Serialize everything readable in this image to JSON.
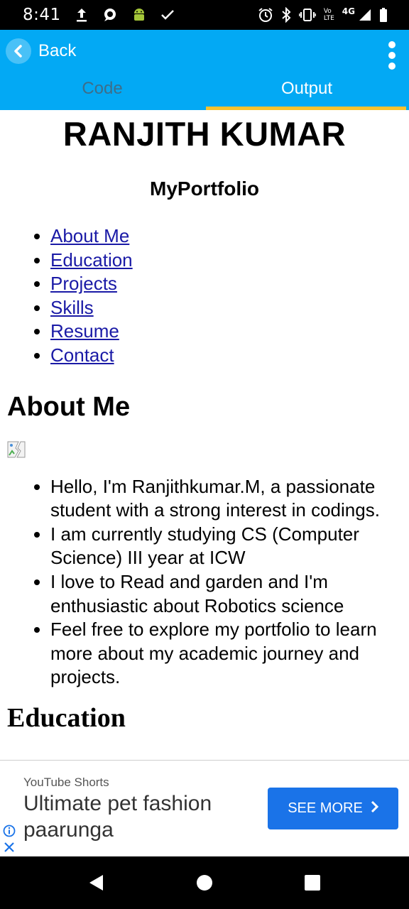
{
  "status_bar": {
    "time": "8:41",
    "lte_label_top": "Vo",
    "lte_label_bottom": "LTE",
    "network_label": "4G"
  },
  "header": {
    "back_label": "Back",
    "accent_color": "#03a9f4",
    "tab_indicator_color": "#f9c22e",
    "tabs": [
      {
        "label": "Code",
        "active": false
      },
      {
        "label": "Output",
        "active": true
      }
    ]
  },
  "page": {
    "name": "RANJITH KUMAR",
    "subtitle": "MyPortfolio",
    "nav_links": [
      "About Me",
      "Education",
      "Projects",
      "Skills",
      "Resume",
      "Contact"
    ],
    "about_heading": "About Me",
    "about_items": [
      "Hello, I'm Ranjithkumar.M, a passionate student with a strong interest in codings.",
      "I am currently studying CS (Computer Science) III year at ICW",
      "I love to Read and garden and I'm enthusiastic about Robotics science",
      "Feel free to explore my portfolio to learn more about my academic journey and projects."
    ],
    "next_heading": "Education"
  },
  "ad": {
    "source": "YouTube Shorts",
    "headline": "Ultimate pet fashion paarunga",
    "cta_label": "SEE MORE",
    "cta_color": "#1a73e8"
  },
  "icons": {
    "status": [
      "upload-icon",
      "chat-icon",
      "android-icon",
      "check-icon",
      "alarm-icon",
      "bluetooth-icon",
      "vibrate-icon",
      "signal-icon",
      "battery-icon"
    ],
    "nav": [
      "back-triangle-icon",
      "home-circle-icon",
      "recents-square-icon"
    ]
  }
}
